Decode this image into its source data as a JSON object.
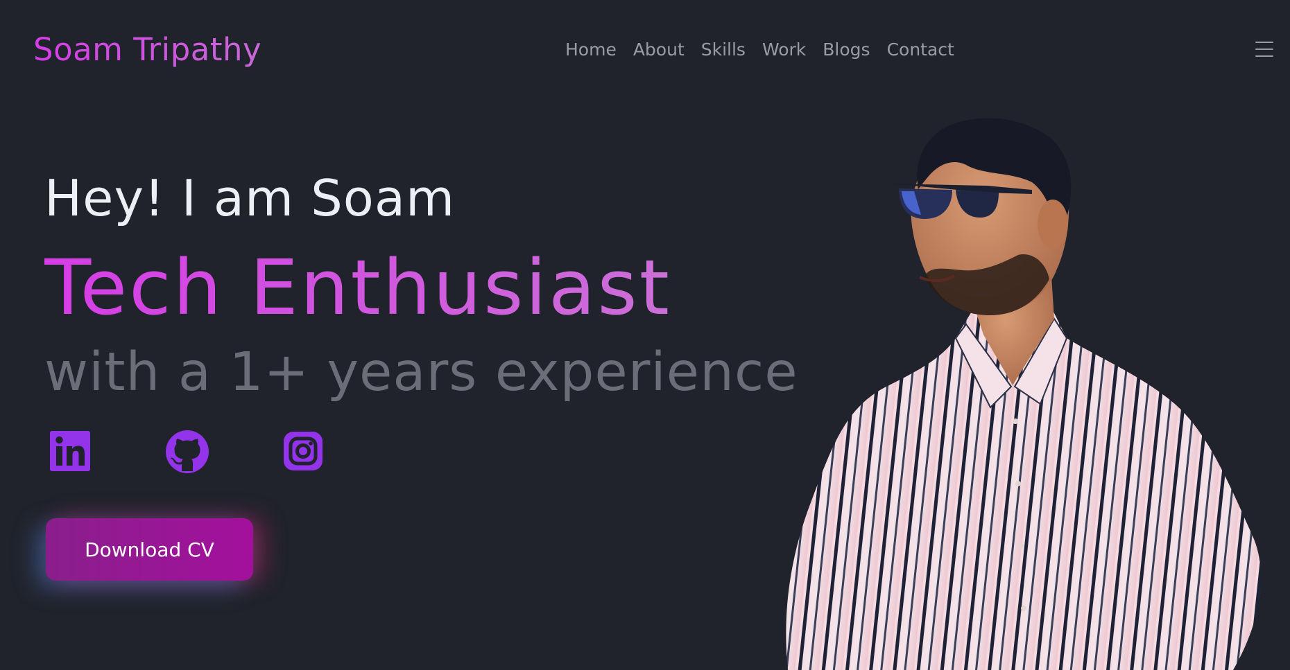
{
  "header": {
    "logo": "Soam Tripathy",
    "nav": [
      "Home",
      "About",
      "Skills",
      "Work",
      "Blogs",
      "Contact"
    ],
    "menu_icon": "hamburger-icon"
  },
  "hero": {
    "greeting": "Hey! I am Soam",
    "role": "Tech Enthusiast",
    "subtitle": "with a 1+ years experience",
    "socials": [
      "linkedin-icon",
      "github-icon",
      "instagram-icon"
    ],
    "cta_label": "Download CV"
  },
  "colors": {
    "background": "#20232b",
    "accent": "#d53ce6",
    "icon": "#9333ea",
    "nav_text": "#9a9ca5",
    "button": "#a3109c"
  }
}
